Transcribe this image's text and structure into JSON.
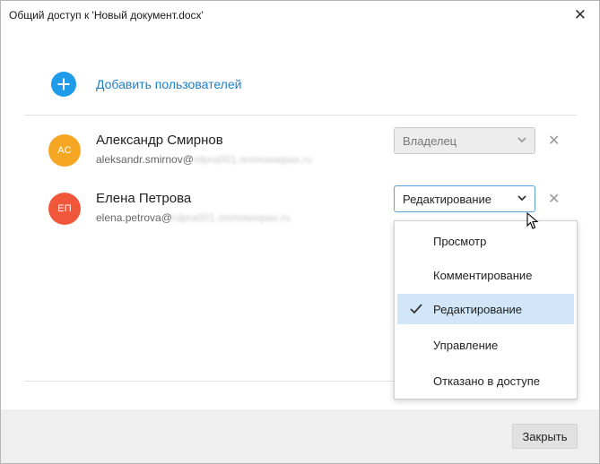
{
  "window": {
    "title": "Общий доступ к 'Новый документ.docx'",
    "close_glyph": "✕"
  },
  "add_users": {
    "label": "Добавить пользователей",
    "icon": "plus-icon",
    "color": "#1e9be9"
  },
  "users": [
    {
      "initials": "АС",
      "name": "Александр Смирнов",
      "email_local": "aleksandr.smirnov@",
      "email_domain_blurred": "rdpra001.onmowwpax.ru",
      "avatar_color": "#f5a623",
      "role": "Владелец",
      "role_disabled": true,
      "remove_glyph": "✕"
    },
    {
      "initials": "ЕП",
      "name": "Елена Петрова",
      "email_local": "elena.petrova@",
      "email_domain_blurred": "rdpra001.onmowwpax.ru",
      "avatar_color": "#f0573a",
      "role": "Редактирование",
      "role_disabled": false,
      "remove_glyph": "✕"
    }
  ],
  "role_dropdown": {
    "options": [
      "Просмотр",
      "Комментирование",
      "Редактирование",
      "Управление",
      "Отказано в доступе"
    ],
    "selected": "Редактирование",
    "selected_bg": "#d1e6f8"
  },
  "footer": {
    "close_label": "Закрыть"
  }
}
